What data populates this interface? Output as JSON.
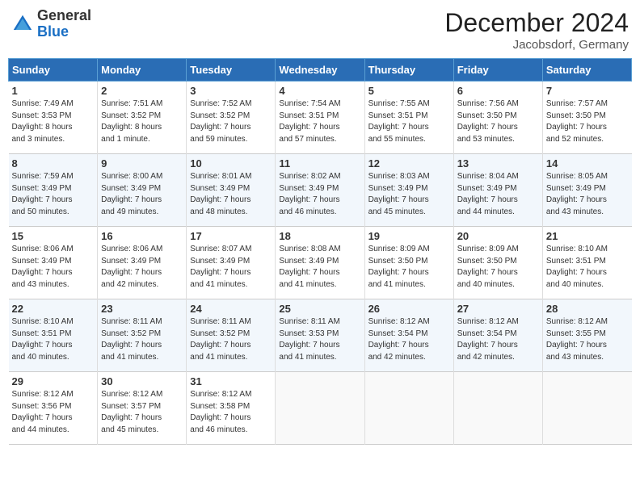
{
  "header": {
    "logo_general": "General",
    "logo_blue": "Blue",
    "title": "December 2024",
    "location": "Jacobsdorf, Germany"
  },
  "days_of_week": [
    "Sunday",
    "Monday",
    "Tuesday",
    "Wednesday",
    "Thursday",
    "Friday",
    "Saturday"
  ],
  "weeks": [
    [
      {
        "day": 1,
        "lines": [
          "Sunrise: 7:49 AM",
          "Sunset: 3:53 PM",
          "Daylight: 8 hours",
          "and 3 minutes."
        ]
      },
      {
        "day": 2,
        "lines": [
          "Sunrise: 7:51 AM",
          "Sunset: 3:52 PM",
          "Daylight: 8 hours",
          "and 1 minute."
        ]
      },
      {
        "day": 3,
        "lines": [
          "Sunrise: 7:52 AM",
          "Sunset: 3:52 PM",
          "Daylight: 7 hours",
          "and 59 minutes."
        ]
      },
      {
        "day": 4,
        "lines": [
          "Sunrise: 7:54 AM",
          "Sunset: 3:51 PM",
          "Daylight: 7 hours",
          "and 57 minutes."
        ]
      },
      {
        "day": 5,
        "lines": [
          "Sunrise: 7:55 AM",
          "Sunset: 3:51 PM",
          "Daylight: 7 hours",
          "and 55 minutes."
        ]
      },
      {
        "day": 6,
        "lines": [
          "Sunrise: 7:56 AM",
          "Sunset: 3:50 PM",
          "Daylight: 7 hours",
          "and 53 minutes."
        ]
      },
      {
        "day": 7,
        "lines": [
          "Sunrise: 7:57 AM",
          "Sunset: 3:50 PM",
          "Daylight: 7 hours",
          "and 52 minutes."
        ]
      }
    ],
    [
      {
        "day": 8,
        "lines": [
          "Sunrise: 7:59 AM",
          "Sunset: 3:49 PM",
          "Daylight: 7 hours",
          "and 50 minutes."
        ]
      },
      {
        "day": 9,
        "lines": [
          "Sunrise: 8:00 AM",
          "Sunset: 3:49 PM",
          "Daylight: 7 hours",
          "and 49 minutes."
        ]
      },
      {
        "day": 10,
        "lines": [
          "Sunrise: 8:01 AM",
          "Sunset: 3:49 PM",
          "Daylight: 7 hours",
          "and 48 minutes."
        ]
      },
      {
        "day": 11,
        "lines": [
          "Sunrise: 8:02 AM",
          "Sunset: 3:49 PM",
          "Daylight: 7 hours",
          "and 46 minutes."
        ]
      },
      {
        "day": 12,
        "lines": [
          "Sunrise: 8:03 AM",
          "Sunset: 3:49 PM",
          "Daylight: 7 hours",
          "and 45 minutes."
        ]
      },
      {
        "day": 13,
        "lines": [
          "Sunrise: 8:04 AM",
          "Sunset: 3:49 PM",
          "Daylight: 7 hours",
          "and 44 minutes."
        ]
      },
      {
        "day": 14,
        "lines": [
          "Sunrise: 8:05 AM",
          "Sunset: 3:49 PM",
          "Daylight: 7 hours",
          "and 43 minutes."
        ]
      }
    ],
    [
      {
        "day": 15,
        "lines": [
          "Sunrise: 8:06 AM",
          "Sunset: 3:49 PM",
          "Daylight: 7 hours",
          "and 43 minutes."
        ]
      },
      {
        "day": 16,
        "lines": [
          "Sunrise: 8:06 AM",
          "Sunset: 3:49 PM",
          "Daylight: 7 hours",
          "and 42 minutes."
        ]
      },
      {
        "day": 17,
        "lines": [
          "Sunrise: 8:07 AM",
          "Sunset: 3:49 PM",
          "Daylight: 7 hours",
          "and 41 minutes."
        ]
      },
      {
        "day": 18,
        "lines": [
          "Sunrise: 8:08 AM",
          "Sunset: 3:49 PM",
          "Daylight: 7 hours",
          "and 41 minutes."
        ]
      },
      {
        "day": 19,
        "lines": [
          "Sunrise: 8:09 AM",
          "Sunset: 3:50 PM",
          "Daylight: 7 hours",
          "and 41 minutes."
        ]
      },
      {
        "day": 20,
        "lines": [
          "Sunrise: 8:09 AM",
          "Sunset: 3:50 PM",
          "Daylight: 7 hours",
          "and 40 minutes."
        ]
      },
      {
        "day": 21,
        "lines": [
          "Sunrise: 8:10 AM",
          "Sunset: 3:51 PM",
          "Daylight: 7 hours",
          "and 40 minutes."
        ]
      }
    ],
    [
      {
        "day": 22,
        "lines": [
          "Sunrise: 8:10 AM",
          "Sunset: 3:51 PM",
          "Daylight: 7 hours",
          "and 40 minutes."
        ]
      },
      {
        "day": 23,
        "lines": [
          "Sunrise: 8:11 AM",
          "Sunset: 3:52 PM",
          "Daylight: 7 hours",
          "and 41 minutes."
        ]
      },
      {
        "day": 24,
        "lines": [
          "Sunrise: 8:11 AM",
          "Sunset: 3:52 PM",
          "Daylight: 7 hours",
          "and 41 minutes."
        ]
      },
      {
        "day": 25,
        "lines": [
          "Sunrise: 8:11 AM",
          "Sunset: 3:53 PM",
          "Daylight: 7 hours",
          "and 41 minutes."
        ]
      },
      {
        "day": 26,
        "lines": [
          "Sunrise: 8:12 AM",
          "Sunset: 3:54 PM",
          "Daylight: 7 hours",
          "and 42 minutes."
        ]
      },
      {
        "day": 27,
        "lines": [
          "Sunrise: 8:12 AM",
          "Sunset: 3:54 PM",
          "Daylight: 7 hours",
          "and 42 minutes."
        ]
      },
      {
        "day": 28,
        "lines": [
          "Sunrise: 8:12 AM",
          "Sunset: 3:55 PM",
          "Daylight: 7 hours",
          "and 43 minutes."
        ]
      }
    ],
    [
      {
        "day": 29,
        "lines": [
          "Sunrise: 8:12 AM",
          "Sunset: 3:56 PM",
          "Daylight: 7 hours",
          "and 44 minutes."
        ]
      },
      {
        "day": 30,
        "lines": [
          "Sunrise: 8:12 AM",
          "Sunset: 3:57 PM",
          "Daylight: 7 hours",
          "and 45 minutes."
        ]
      },
      {
        "day": 31,
        "lines": [
          "Sunrise: 8:12 AM",
          "Sunset: 3:58 PM",
          "Daylight: 7 hours",
          "and 46 minutes."
        ]
      },
      null,
      null,
      null,
      null
    ]
  ]
}
